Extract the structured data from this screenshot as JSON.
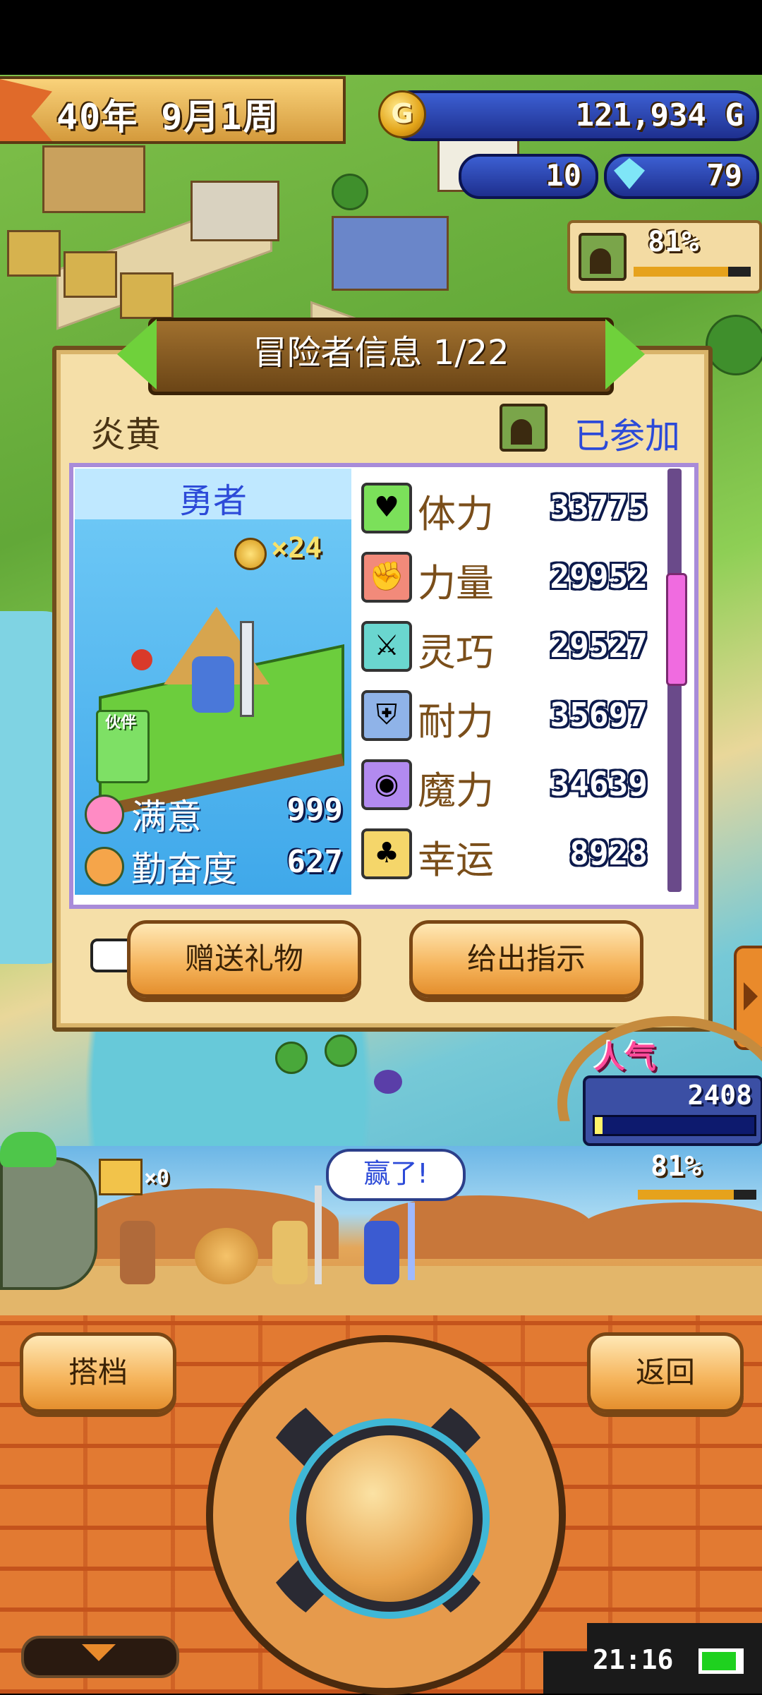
{
  "hud": {
    "date": "40年 9月1周",
    "gold": "121,934 G",
    "coin_icon": "gold-coin-icon",
    "counter_a": "10",
    "counter_b": "79",
    "camp_percent": "81%",
    "camp_progress": 0.81
  },
  "dialog": {
    "title": "冒险者信息 1/22",
    "adventurer_name": "炎黄",
    "status": "已参加",
    "job": "勇者",
    "medal_count": "×24",
    "partner_label": "伙伴",
    "satisfaction_label": "满意",
    "satisfaction_value": "999",
    "diligence_label": "勤奋度",
    "diligence_value": "627",
    "stats": [
      {
        "label": "体力",
        "value": "33775",
        "icon": "heart-icon",
        "color": "#7be05a"
      },
      {
        "label": "力量",
        "value": "29952",
        "icon": "arm-icon",
        "color": "#f28a7a"
      },
      {
        "label": "灵巧",
        "value": "29527",
        "icon": "crossed-swords-icon",
        "color": "#6ad6cf"
      },
      {
        "label": "耐力",
        "value": "35697",
        "icon": "shield-icon",
        "color": "#8fb3e8"
      },
      {
        "label": "魔力",
        "value": "34639",
        "icon": "magic-orb-icon",
        "color": "#b28af0"
      },
      {
        "label": "幸运",
        "value": "8928",
        "icon": "clover-icon",
        "color": "#f5d66a"
      }
    ],
    "gift_button": "赠送礼物",
    "instruct_button": "给出指示"
  },
  "popularity": {
    "label": "人气",
    "value": "2408",
    "progress": 0.05
  },
  "party_strip": {
    "counter_icon": "treasure-chest-icon",
    "counter": "×0",
    "speech": "赢了!",
    "percent": "81%",
    "progress": 0.81
  },
  "controls": {
    "partner_button": "搭档",
    "back_button": "返回"
  },
  "system": {
    "clock": "21:16"
  },
  "colors": {
    "title_banner": "#8a5a22",
    "panel_bg": "#f5dfa8",
    "value_outline": "#0c1a4c",
    "accent_blue": "#2c4ad8"
  }
}
